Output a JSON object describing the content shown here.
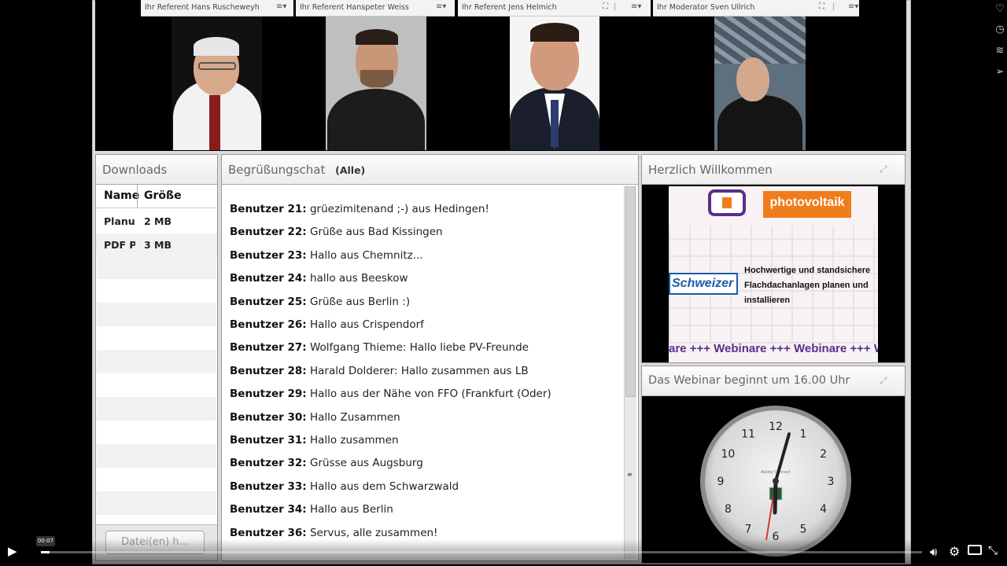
{
  "webcams": [
    {
      "title": "Ihr Referent Hans Ruscheweyh"
    },
    {
      "title": "Ihr Referent Hanspeter Weiss"
    },
    {
      "title": "Ihr Referent Jens Helmich"
    },
    {
      "title": "Ihr Moderator Sven Ullrich"
    }
  ],
  "downloads": {
    "title": "Downloads",
    "columns": [
      "Name",
      "Größe"
    ],
    "files": [
      {
        "name": "Planui",
        "size": "2 MB"
      },
      {
        "name": "PDF P",
        "size": "3 MB"
      }
    ],
    "button_label": "Datei(en) h..."
  },
  "chat": {
    "title": "Begrüßungschat",
    "scope": "(Alle)",
    "messages": [
      {
        "user": "Benutzer 21:",
        "text": "grüezimitenand ;-) aus Hedingen!"
      },
      {
        "user": "Benutzer 22:",
        "text": "Grüße aus Bad Kissingen"
      },
      {
        "user": "Benutzer 23:",
        "text": "Hallo aus Chemnitz..."
      },
      {
        "user": "Benutzer 24:",
        "text": "hallo aus Beeskow"
      },
      {
        "user": "Benutzer 25:",
        "text": "Grüße aus Berlin :)"
      },
      {
        "user": "Benutzer 26:",
        "text": "Hallo aus Crispendorf"
      },
      {
        "user": "Benutzer 27:",
        "text": "Wolfgang Thieme: Hallo liebe PV-Freunde"
      },
      {
        "user": "Benutzer 28:",
        "text": "Harald Dolderer: Hallo zusammen aus LB"
      },
      {
        "user": "Benutzer 29:",
        "text": "Hallo aus der Nähe von FFO (Frankfurt (Oder)"
      },
      {
        "user": "Benutzer 30:",
        "text": "Hallo Zusammen"
      },
      {
        "user": "Benutzer 31:",
        "text": "Hallo zusammen"
      },
      {
        "user": "Benutzer 32:",
        "text": "Grüsse aus Augsburg"
      },
      {
        "user": "Benutzer 33:",
        "text": "Hallo aus dem Schwarzwald"
      },
      {
        "user": "Benutzer 34:",
        "text": "Hallo aus Berlin"
      },
      {
        "user": "Benutzer 36:",
        "text": "Servus, alle zusammen!"
      }
    ]
  },
  "welcome": {
    "title": "Herzlich Willkommen",
    "logo_text": "photovoltaik",
    "brand": "Schweizer",
    "headline": [
      "Hochwertige und standsichere",
      "Flachdachanlagen planen und",
      "installieren"
    ],
    "ticker": "are +++ Webinare +++ Webinare +++ W"
  },
  "clock": {
    "title": "Das Webinar beginnt um 16.00 Uhr",
    "brand": "Adobe Connect",
    "numbers": [
      "12",
      "1",
      "2",
      "3",
      "4",
      "5",
      "6",
      "7",
      "8",
      "9",
      "10",
      "11"
    ]
  },
  "player": {
    "timestamp": "00:07",
    "progress": 0.01
  },
  "colors": {
    "ticker": "#5a2d8c",
    "photovoltaik_bg": "#f07d1c",
    "schweizer_blue": "#1e5aa8"
  }
}
